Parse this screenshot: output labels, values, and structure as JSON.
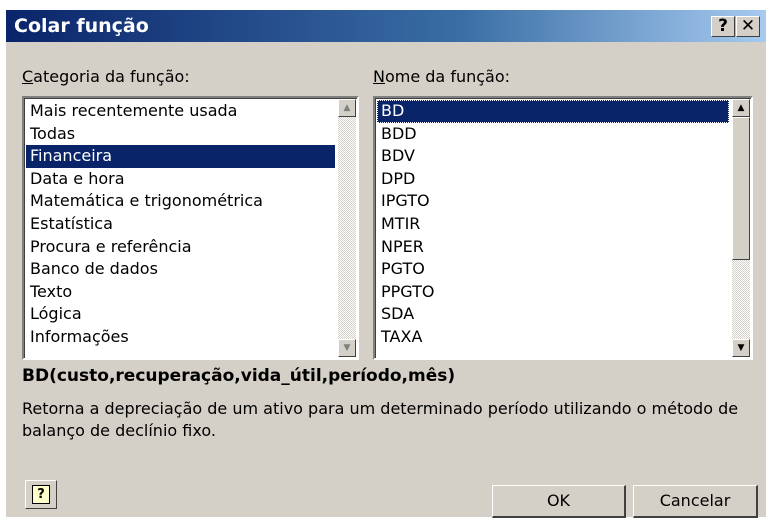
{
  "dialog": {
    "title": "Colar função",
    "help_glyph": "?",
    "close_glyph": "✕"
  },
  "category": {
    "label_mnemonic": "C",
    "label_rest": "ategoria da função:",
    "items": [
      "Mais recentemente usada",
      "Todas",
      "Financeira",
      "Data e hora",
      "Matemática e trigonométrica",
      "Estatística",
      "Procura e referência",
      "Banco de dados",
      "Texto",
      "Lógica",
      "Informações"
    ],
    "selected_index": 2
  },
  "function_name": {
    "label_mnemonic": "N",
    "label_rest": "ome da função:",
    "items": [
      "BD",
      "BDD",
      "BDV",
      "DPD",
      "IPGTO",
      "MTIR",
      "NPER",
      "PGTO",
      "PPGTO",
      "SDA",
      "TAXA"
    ],
    "selected_index": 0
  },
  "syntax": "BD(custo,recuperação,vida_útil,período,mês)",
  "description": "Retorna a depreciação de um ativo para um determinado período utilizando o método de balanço de declínio fixo.",
  "buttons": {
    "ok_label": "OK",
    "cancel_label": "Cancelar",
    "help_glyph": "?"
  },
  "icons": {
    "scroll_up": "▲",
    "scroll_down": "▼"
  },
  "colors": {
    "selection": "#0a246a",
    "face": "#d4d0c8"
  }
}
